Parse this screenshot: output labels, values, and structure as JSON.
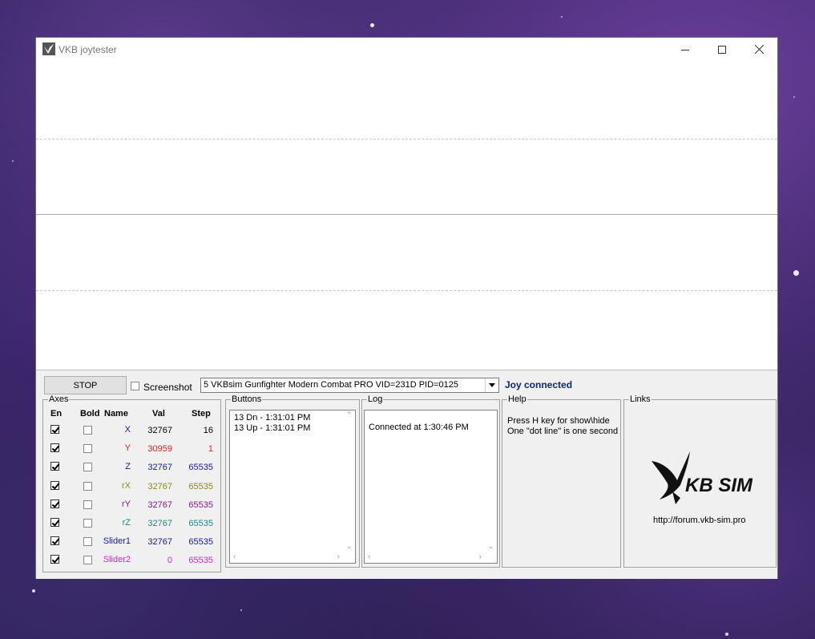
{
  "window": {
    "title": "VKB joytester"
  },
  "toolbar": {
    "stop_label": "STOP",
    "screenshot_label": "Screenshot",
    "screenshot_checked": false,
    "device_selected": "5 VKBsim Gunfighter Modern Combat PRO  VID=231D PID=0125",
    "joy_status": "Joy connected"
  },
  "axes": {
    "group_label": "Axes",
    "headers": {
      "en": "En",
      "bold": "Bold",
      "name": "Name",
      "val": "Val",
      "step": "Step"
    },
    "rows": [
      {
        "name": "X",
        "val": "32767",
        "step": "16",
        "color": "#1a1a8a",
        "val_color": "#000000",
        "step_color": "#000000",
        "enabled": true,
        "bold": false
      },
      {
        "name": "Y",
        "val": "30959",
        "step": "1",
        "color": "#e02020",
        "val_color": "#e02020",
        "step_color": "#e02020",
        "enabled": true,
        "bold": false
      },
      {
        "name": "Z",
        "val": "32767",
        "step": "65535",
        "color": "#1a1a8a",
        "val_color": "#1a1a8a",
        "step_color": "#1a1a8a",
        "enabled": true,
        "bold": false
      },
      {
        "name": "rX",
        "val": "32767",
        "step": "65535",
        "color": "#8a8a1a",
        "val_color": "#8a8a1a",
        "step_color": "#8a8a1a",
        "enabled": true,
        "bold": false
      },
      {
        "name": "rY",
        "val": "32767",
        "step": "65535",
        "color": "#8a1a8a",
        "val_color": "#8a1a8a",
        "step_color": "#8a1a8a",
        "enabled": true,
        "bold": false
      },
      {
        "name": "rZ",
        "val": "32767",
        "step": "65535",
        "color": "#1a8a8a",
        "val_color": "#1a8a8a",
        "step_color": "#1a8a8a",
        "enabled": true,
        "bold": false
      },
      {
        "name": "Slider1",
        "val": "32767",
        "step": "65535",
        "color": "#1a1a9a",
        "val_color": "#1a1a9a",
        "step_color": "#1a1a9a",
        "enabled": true,
        "bold": false
      },
      {
        "name": "Slider2",
        "val": "0",
        "step": "65535",
        "color": "#e020e0",
        "val_color": "#e020e0",
        "step_color": "#e020e0",
        "enabled": true,
        "bold": false
      }
    ]
  },
  "buttons_log": {
    "group_label": "Buttons",
    "lines": [
      "13 Dn - 1:31:01 PM",
      "13 Up - 1:31:01 PM"
    ]
  },
  "log": {
    "group_label": "Log",
    "lines": [
      "Connected at 1:30:46 PM"
    ]
  },
  "help": {
    "group_label": "Help",
    "lines": [
      "Press H key for show\\hide",
      "One \"dot line\" is one second"
    ]
  },
  "links": {
    "group_label": "Links",
    "url": "http://forum.vkb-sim.pro",
    "logo_text": "KB SIM"
  },
  "colors": {
    "joy_status": "#0b2a6a",
    "panel_bg": "#f0f0f0"
  }
}
